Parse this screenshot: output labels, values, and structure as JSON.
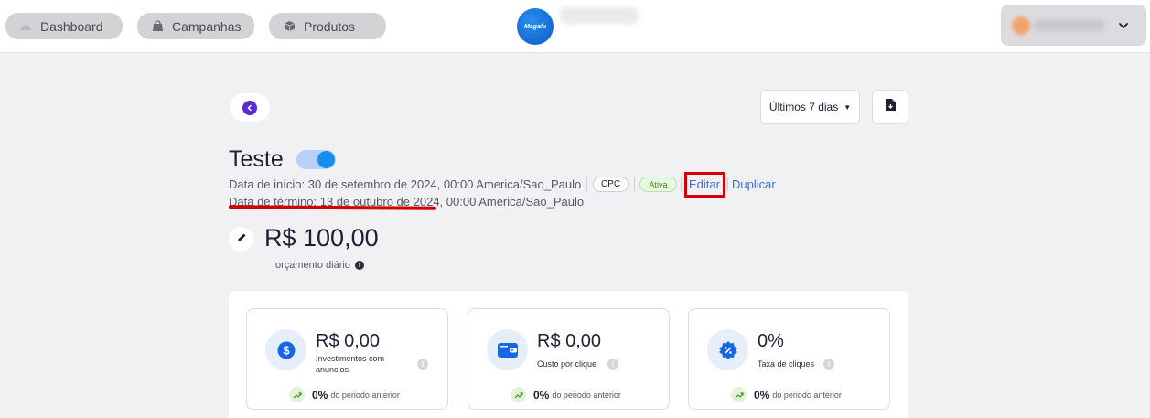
{
  "nav": {
    "items": [
      {
        "label": "Dashboard",
        "icon": "dashboard-icon"
      },
      {
        "label": "Campanhas",
        "icon": "bag-icon"
      },
      {
        "label": "Produtos",
        "icon": "box-icon"
      }
    ]
  },
  "brand": {
    "logo_text": "Magalu"
  },
  "controls": {
    "date_range": "Últimos 7 dias"
  },
  "campaign": {
    "title": "Teste",
    "active": true,
    "start": "Data de início: 30 de setembro de 2024, 00:00 America/Sao_Paulo",
    "end": "Data de término: 13 de outubro de 2024, 00:00 America/Sao_Paulo",
    "type_badge": "CPC",
    "status_badge": "Ativa",
    "edit_link": "Editar",
    "duplicate_link": "Duplicar",
    "budget_value": "R$ 100,00",
    "budget_label": "orçamento diário"
  },
  "metrics": [
    {
      "value": "R$ 0,00",
      "label": "Investimentos com anuncios",
      "trend_value": "0%",
      "trend_label": "do periodo anterior",
      "icon": "dollar-icon"
    },
    {
      "value": "R$ 0,00",
      "label": "Custo por clique",
      "trend_value": "0%",
      "trend_label": "do periodo anterior",
      "icon": "wallet-icon"
    },
    {
      "value": "0%",
      "label": "Taxa de cliques",
      "trend_value": "0%",
      "trend_label": "do periodo anterior",
      "icon": "percent-badge-icon"
    }
  ],
  "colors": {
    "accent": "#1a8cf0",
    "back_button": "#5b2bd6",
    "highlight": "#d30000",
    "link": "#3d6fd6",
    "status_green": "#3a8a24"
  }
}
